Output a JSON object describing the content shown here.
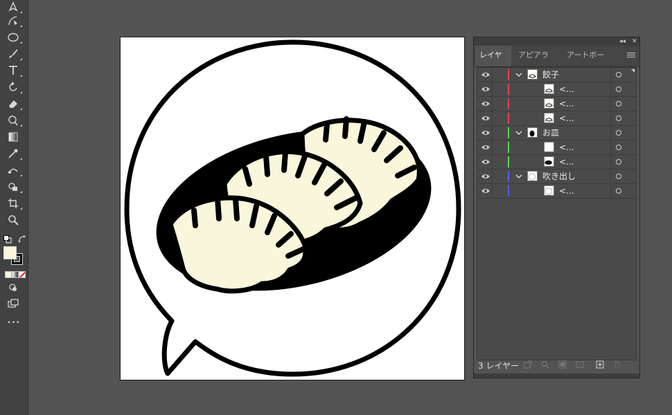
{
  "toolbar": {
    "tools": [
      "pen-tool-icon",
      "curvature-tool-icon",
      "ellipse-tool-icon",
      "paintbrush-tool-icon",
      "type-tool-icon",
      "rotate-tool-icon",
      "eraser-tool-icon",
      "puppet-warp-tool-icon",
      "gradient-tool-icon",
      "eyedropper-tool-icon",
      "blend-tool-icon",
      "shape-builder-tool-icon",
      "artboard-tool-icon",
      "zoom-tool-icon"
    ],
    "fill_color": "#f9f6dc",
    "stroke_color": "#000000",
    "more_label": "•••"
  },
  "layers_panel": {
    "tabs": [
      {
        "label": "レイヤー",
        "active": true
      },
      {
        "label": "アピアランス",
        "active": false
      },
      {
        "label": "アートボード",
        "active": false
      }
    ],
    "layers": [
      {
        "name": "餃子",
        "color": "#e0474c",
        "expanded": true,
        "sublayers": [
          "<...",
          "<...",
          "<..."
        ]
      },
      {
        "name": "お皿",
        "color": "#4fdc4f",
        "expanded": true,
        "sublayers": [
          "<...",
          "<..."
        ]
      },
      {
        "name": "吹き出し",
        "color": "#5560e6",
        "expanded": true,
        "sublayers": [
          "<..."
        ]
      }
    ],
    "footer": {
      "count_label": "3 レイヤー"
    }
  },
  "artwork": {
    "fill_cream": "#f9f6dc",
    "ink": "#000000",
    "paper": "#ffffff"
  }
}
